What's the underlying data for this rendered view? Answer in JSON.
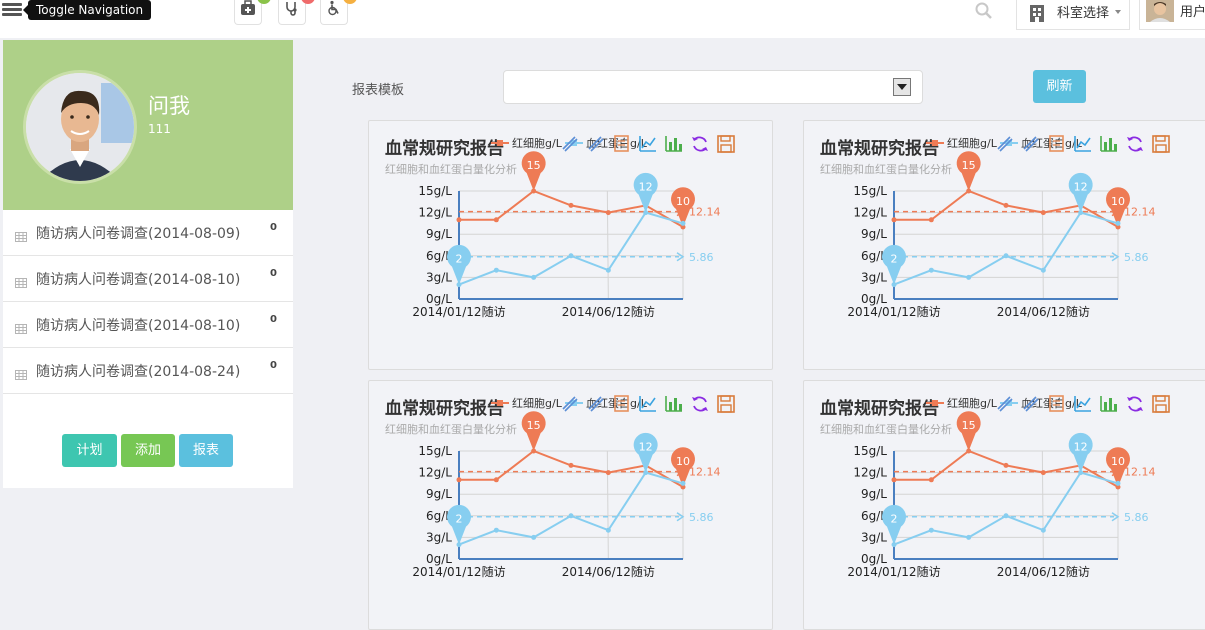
{
  "topbar": {
    "toggle_tooltip": "Toggle Navigation",
    "dept_label": "科室选择",
    "user_label": "用户",
    "icons": [
      "hamburger-icon",
      "medical-kit-icon",
      "stethoscope-icon",
      "wheelchair-icon",
      "search-icon",
      "building-icon"
    ],
    "badge_colors": [
      "#8bc34a",
      "#ef6b6b",
      "#f5b041"
    ]
  },
  "sidebar": {
    "profile": {
      "name": "问我",
      "id": "111"
    },
    "items": [
      {
        "label": "随访病人问卷调查(2014-08-09)",
        "count": "0"
      },
      {
        "label": "随访病人问卷调查(2014-08-10)",
        "count": "0"
      },
      {
        "label": "随访病人问卷调查(2014-08-10)",
        "count": "0"
      },
      {
        "label": "随访病人问卷调查(2014-08-24)",
        "count": "0"
      }
    ],
    "buttons": {
      "plan": "计划",
      "add": "添加",
      "report": "报表"
    },
    "button_colors": {
      "plan": "#3ec6b0",
      "add": "#77c754",
      "report": "#5bc0de"
    }
  },
  "main": {
    "template_label": "报表模板",
    "template_value": "",
    "refresh_label": "刷新"
  },
  "chart_data": [
    {
      "type": "line",
      "title": "血常规研究报告",
      "subtitle": "红细胞和血红蛋白量化分析",
      "x": [
        "2014/01/12随访",
        "",
        "",
        "",
        "2014/06/12随访",
        "",
        ""
      ],
      "series": [
        {
          "name": "红细胞g/L",
          "values": [
            11,
            11,
            15,
            13,
            12,
            13,
            10
          ],
          "color": "#ee7b55",
          "max_label": "15",
          "min_label": "10",
          "average": 12.14
        },
        {
          "name": "血红蛋白g/L",
          "values": [
            2,
            4,
            3,
            6,
            4,
            12,
            10.5
          ],
          "color": "#87cef0",
          "max_label": "12",
          "min_label": "2",
          "average": 5.86
        }
      ],
      "yticks": [
        "15g/L",
        "12g/L",
        "9g/L",
        "6g/L",
        "3g/L",
        "0g/L"
      ],
      "ylim": [
        0,
        15
      ]
    },
    {
      "type": "line",
      "title": "血常规研究报告",
      "subtitle": "红细胞和血红蛋白量化分析",
      "x": [
        "2014/01/12随访",
        "",
        "",
        "",
        "2014/06/12随访",
        "",
        ""
      ],
      "series": [
        {
          "name": "红细胞g/L",
          "values": [
            11,
            11,
            15,
            13,
            12,
            13,
            10
          ],
          "color": "#ee7b55",
          "max_label": "15",
          "min_label": "10",
          "average": 12.14
        },
        {
          "name": "血红蛋白g/L",
          "values": [
            2,
            4,
            3,
            6,
            4,
            12,
            10.5
          ],
          "color": "#87cef0",
          "max_label": "12",
          "min_label": "2",
          "average": 5.86
        }
      ],
      "yticks": [
        "15g/L",
        "12g/L",
        "9g/L",
        "6g/L",
        "3g/L",
        "0g/L"
      ],
      "ylim": [
        0,
        15
      ]
    },
    {
      "type": "line",
      "title": "血常规研究报告",
      "subtitle": "红细胞和血红蛋白量化分析",
      "x": [
        "2014/01/12随访",
        "",
        "",
        "",
        "2014/06/12随访",
        "",
        ""
      ],
      "series": [
        {
          "name": "红细胞g/L",
          "values": [
            11,
            11,
            15,
            13,
            12,
            13,
            10
          ],
          "color": "#ee7b55",
          "max_label": "15",
          "min_label": "10",
          "average": 12.14
        },
        {
          "name": "血红蛋白g/L",
          "values": [
            2,
            4,
            3,
            6,
            4,
            12,
            10.5
          ],
          "color": "#87cef0",
          "max_label": "12",
          "min_label": "2",
          "average": 5.86
        }
      ],
      "yticks": [
        "15g/L",
        "12g/L",
        "9g/L",
        "6g/L",
        "3g/L",
        "0g/L"
      ],
      "ylim": [
        0,
        15
      ]
    },
    {
      "type": "line",
      "title": "血常规研究报告",
      "subtitle": "红细胞和血红蛋白量化分析",
      "x": [
        "2014/01/12随访",
        "",
        "",
        "",
        "2014/06/12随访",
        "",
        ""
      ],
      "series": [
        {
          "name": "红细胞g/L",
          "values": [
            11,
            11,
            15,
            13,
            12,
            13,
            10
          ],
          "color": "#ee7b55",
          "max_label": "15",
          "min_label": "10",
          "average": 12.14
        },
        {
          "name": "血红蛋白g/L",
          "values": [
            2,
            4,
            3,
            6,
            4,
            12,
            10.5
          ],
          "color": "#87cef0",
          "max_label": "12",
          "min_label": "2",
          "average": 5.86
        }
      ],
      "yticks": [
        "15g/L",
        "12g/L",
        "9g/L",
        "6g/L",
        "3g/L",
        "0g/L"
      ],
      "ylim": [
        0,
        15
      ]
    }
  ],
  "toolbox_icons": [
    "mark-icon",
    "data-zoom-icon",
    "data-view-icon",
    "line-chart-icon",
    "bar-chart-icon",
    "restore-icon",
    "save-image-icon"
  ]
}
